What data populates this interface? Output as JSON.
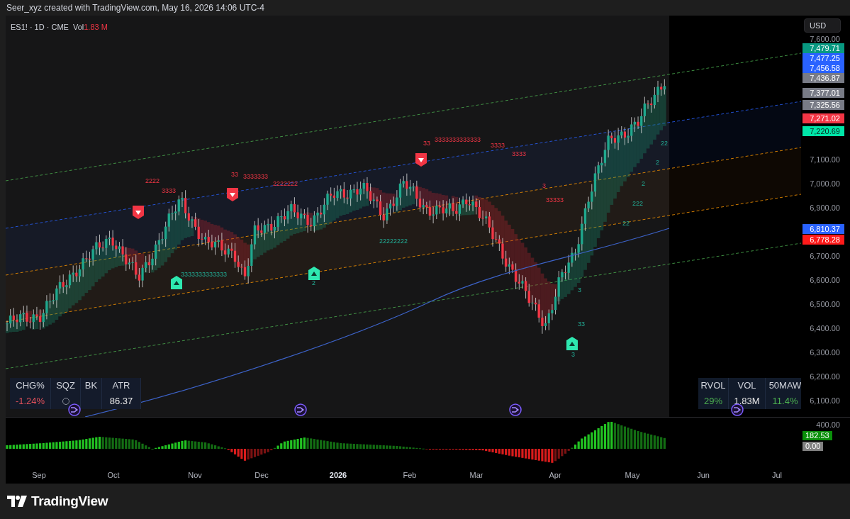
{
  "attribution": "Seer_xyz created with TradingView.com, May 16, 2026 14:06 UTC-4",
  "legend": {
    "symbol": "ES1! · 1D · CME",
    "volume_label": "Vol",
    "volume_value": "1.83 M"
  },
  "signals": [
    {
      "kind": "sell"
    },
    {
      "kind": "sell"
    },
    {
      "kind": "sell"
    },
    {
      "kind": "buy"
    },
    {
      "kind": "buy"
    },
    {
      "kind": "buy"
    }
  ],
  "count_labels": [
    {
      "text": "2222",
      "kind": "bear"
    },
    {
      "text": "3333",
      "kind": "bear"
    },
    {
      "text": "33",
      "kind": "bear"
    },
    {
      "text": "3333333",
      "kind": "bear"
    },
    {
      "text": "2222222",
      "kind": "bear"
    },
    {
      "text": "33",
      "kind": "bear"
    },
    {
      "text": "3333333333333",
      "kind": "bear"
    },
    {
      "text": "3333",
      "kind": "bear"
    },
    {
      "text": "3333",
      "kind": "bear"
    },
    {
      "text": "3",
      "kind": "bear"
    },
    {
      "text": "33333",
      "kind": "bear"
    },
    {
      "text": "3333333333333",
      "kind": "bull"
    },
    {
      "text": "2",
      "kind": "bull"
    },
    {
      "text": "22222222",
      "kind": "bull"
    },
    {
      "text": "3",
      "kind": "bull"
    },
    {
      "text": "33",
      "kind": "bull"
    },
    {
      "text": "3",
      "kind": "bull"
    },
    {
      "text": "22",
      "kind": "bull"
    },
    {
      "text": "2",
      "kind": "bull"
    },
    {
      "text": "2",
      "kind": "bull"
    },
    {
      "text": "222",
      "kind": "bull"
    },
    {
      "text": "22",
      "kind": "bull"
    }
  ],
  "stats_left": {
    "columns": [
      "CHG%",
      "SQZ",
      "BK",
      "ATR"
    ],
    "values": [
      {
        "kind": "text",
        "text": "-1.24%",
        "color": "#e0505a"
      },
      {
        "kind": "circle"
      },
      {
        "kind": "covered"
      },
      {
        "kind": "text",
        "text": "86.37",
        "color": "#e6e6e6"
      }
    ]
  },
  "stats_right": {
    "columns": [
      "RVOL",
      "VOL",
      "50MAW"
    ],
    "values": [
      {
        "kind": "text",
        "text": "29%",
        "color": "#4caf50"
      },
      {
        "kind": "text",
        "text": "1.83M",
        "color": "#e6e6e6"
      },
      {
        "kind": "text",
        "text": "11.4%",
        "color": "#4caf50"
      }
    ]
  },
  "price_axis": {
    "currency": "USD",
    "ticks": [
      "7,600.00",
      "7,100.00",
      "7,000.00",
      "6,900.00",
      "6,700.00",
      "6,600.00",
      "6,500.00",
      "6,400.00",
      "6,300.00",
      "6,200.00",
      "6,100.00"
    ],
    "labels": [
      {
        "text": "7,479.71",
        "color": "#089981"
      },
      {
        "text": "7,477.25",
        "color": "#2962ff"
      },
      {
        "text": "7,456.58",
        "color": "#2962ff"
      },
      {
        "text": "7,436.87",
        "color": "#787b86"
      },
      {
        "text": "7,377.01",
        "color": "#787b86"
      },
      {
        "text": "7,325.56",
        "color": "#787b86"
      },
      {
        "text": "7,271.02",
        "color": "#f23645"
      },
      {
        "text": "7,220.69",
        "color": "#00e6a8"
      },
      {
        "text": "6,810.37",
        "color": "#2962ff"
      },
      {
        "text": "6,778.28",
        "color": "#ff1a1a"
      }
    ]
  },
  "oscillator_axis": {
    "ticks": [
      "400.00"
    ],
    "labels": [
      {
        "text": "182.53",
        "color": "#0a8f0a"
      },
      {
        "text": "0.00",
        "color": "#808080"
      }
    ]
  },
  "time_axis": [
    {
      "label": "Sep",
      "emphasis": false
    },
    {
      "label": "Oct",
      "emphasis": false
    },
    {
      "label": "Nov",
      "emphasis": false
    },
    {
      "label": "Dec",
      "emphasis": false
    },
    {
      "label": "2026",
      "emphasis": true
    },
    {
      "label": "Feb",
      "emphasis": false
    },
    {
      "label": "Mar",
      "emphasis": false
    },
    {
      "label": "Apr",
      "emphasis": false
    },
    {
      "label": "May",
      "emphasis": false
    },
    {
      "label": "Jun",
      "emphasis": false
    },
    {
      "label": "Jul",
      "emphasis": false
    }
  ],
  "footer": {
    "brand": "TradingView"
  }
}
